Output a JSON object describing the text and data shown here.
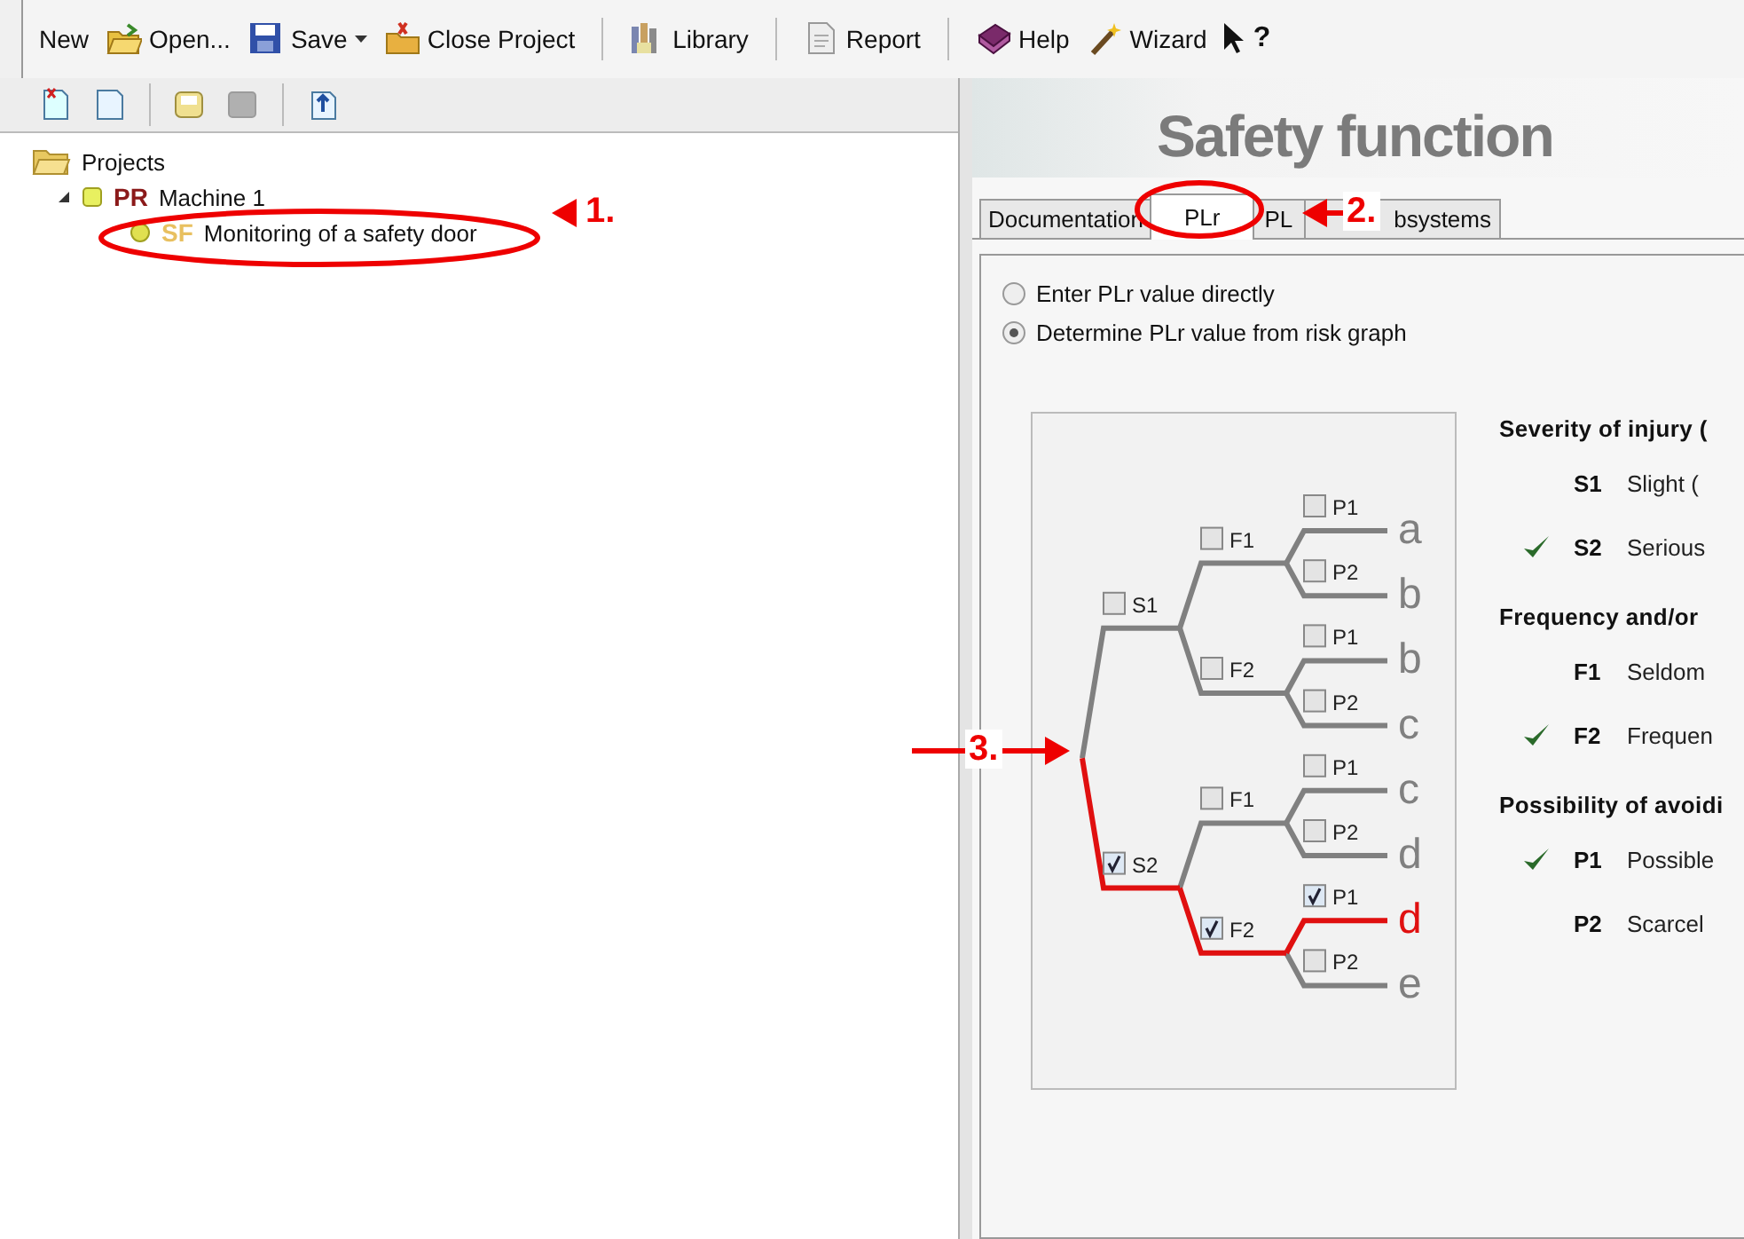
{
  "toolbar": [
    {
      "kind": "new",
      "label": "New"
    },
    {
      "kind": "open",
      "label": "Open..."
    },
    {
      "kind": "save",
      "label": "Save",
      "dropdown": true
    },
    {
      "kind": "close",
      "label": "Close Project",
      "group_end": true
    },
    {
      "kind": "library",
      "label": "Library",
      "group_end": true
    },
    {
      "kind": "report",
      "label": "Report",
      "group_end": true
    },
    {
      "kind": "help",
      "label": "Help"
    },
    {
      "kind": "wizard",
      "label": "Wizard"
    },
    {
      "kind": "whatsthis",
      "label": "?"
    }
  ],
  "project_toolbar": [
    {
      "kind": "new-doc"
    },
    {
      "kind": "sheet",
      "group_end": true
    },
    {
      "kind": "disk"
    },
    {
      "kind": "grey-disk",
      "disabled": true,
      "group_end": true
    },
    {
      "kind": "export"
    }
  ],
  "tree": [
    {
      "label": "Projects",
      "kind": "folder",
      "expanded": true,
      "children": [
        {
          "badge": "PR",
          "label": "Machine 1",
          "kind": "project",
          "expanded": true,
          "children": [
            {
              "badge": "SF",
              "label": "Monitoring of a safety door",
              "kind": "function"
            }
          ]
        }
      ]
    }
  ],
  "header": {
    "title": "Safety function"
  },
  "tabs": [
    {
      "label": "Documentation",
      "selected": false
    },
    {
      "label": "PLr",
      "selected": true
    },
    {
      "label": "PL",
      "selected": false
    },
    {
      "label": "bsystems",
      "selected": false
    }
  ],
  "plr_mode": [
    {
      "label": "Enter PLr value directly",
      "selected": false
    },
    {
      "label": "Determine PLr value from risk graph",
      "selected": true
    }
  ],
  "risk_graph": [
    {
      "label": "S1",
      "checked": false,
      "children": [
        {
          "label": "F1",
          "checked": false,
          "children": [
            {
              "label": "P1",
              "checked": false,
              "result": "a"
            },
            {
              "label": "P2",
              "checked": false,
              "result": "b"
            }
          ]
        },
        {
          "label": "F2",
          "checked": false,
          "children": [
            {
              "label": "P1",
              "checked": false,
              "result": "b"
            },
            {
              "label": "P2",
              "checked": false,
              "result": "c"
            }
          ]
        }
      ]
    },
    {
      "label": "S2",
      "checked": true,
      "children": [
        {
          "label": "F1",
          "checked": false,
          "children": [
            {
              "label": "P1",
              "checked": false,
              "result": "c"
            },
            {
              "label": "P2",
              "checked": false,
              "result": "d"
            }
          ]
        },
        {
          "label": "F2",
          "checked": true,
          "children": [
            {
              "label": "P1",
              "checked": true,
              "result": "d"
            },
            {
              "label": "P2",
              "checked": false,
              "result": "e"
            }
          ]
        }
      ]
    }
  ],
  "criteria": [
    {
      "heading": "Severity of injury (",
      "items": [
        {
          "code": "S1",
          "text": "Slight (",
          "selected": false
        },
        {
          "code": "S2",
          "text": "Serious",
          "selected": true
        }
      ]
    },
    {
      "heading": "Frequency and/or",
      "items": [
        {
          "code": "F1",
          "text": "Seldom",
          "selected": false
        },
        {
          "code": "F2",
          "text": "Frequen",
          "selected": true
        }
      ]
    },
    {
      "heading": "Possibility of avoidi",
      "items": [
        {
          "code": "P1",
          "text": "Possible",
          "selected": true
        },
        {
          "code": "P2",
          "text": "Scarcel",
          "selected": false
        }
      ]
    }
  ],
  "annotations": [
    {
      "label": "1."
    },
    {
      "label": "2."
    },
    {
      "label": "3."
    }
  ]
}
